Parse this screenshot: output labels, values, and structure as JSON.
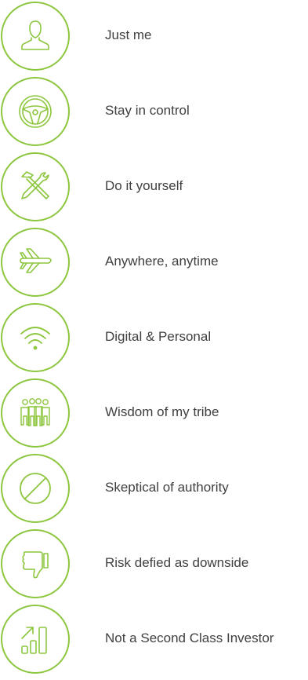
{
  "colors": {
    "accent": "#8dc63f",
    "text": "#404040"
  },
  "items": [
    {
      "label": "Just me",
      "icon": "person-icon"
    },
    {
      "label": "Stay in control",
      "icon": "steering-wheel-icon"
    },
    {
      "label": "Do it yourself",
      "icon": "tools-icon"
    },
    {
      "label": "Anywhere, anytime",
      "icon": "airplane-icon"
    },
    {
      "label": "Digital & Personal",
      "icon": "wifi-icon"
    },
    {
      "label": "Wisdom of my tribe",
      "icon": "group-icon"
    },
    {
      "label": "Skeptical of authority",
      "icon": "prohibited-icon"
    },
    {
      "label": "Risk defied as downside",
      "icon": "thumbs-down-icon"
    },
    {
      "label": "Not a Second Class Investor",
      "icon": "growth-chart-icon"
    }
  ]
}
